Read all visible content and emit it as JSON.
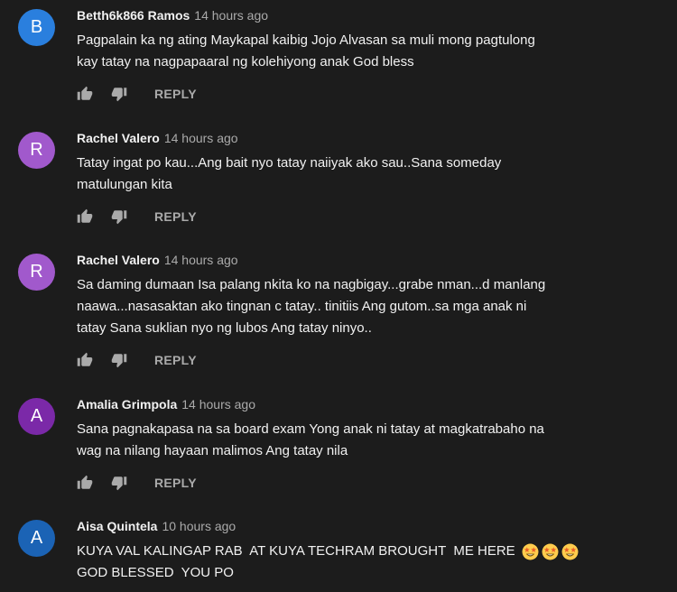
{
  "theme": {
    "background": "#1c1c1c",
    "text": "#f1f1f1",
    "secondary_text": "#aaaaaa"
  },
  "icons": {
    "like": "thumb-up-icon",
    "dislike": "thumb-down-icon",
    "emoji": "star-struck-emoji-icon"
  },
  "comments": [
    {
      "avatar_letter": "B",
      "avatar_color": "#2a7fde",
      "author": "Betth6k866 Ramos",
      "time": "14 hours ago",
      "text_lines": [
        "Pagpalain ka ng ating Maykapal kaibig Jojo Alvasan sa muli mong pagtulong",
        "kay tatay na nagpapaaral ng kolehiyong anak God bless"
      ],
      "reply_label": "REPLY"
    },
    {
      "avatar_letter": "R",
      "avatar_color": "#a159cc",
      "author": "Rachel Valero",
      "time": "14 hours ago",
      "text_lines": [
        "Tatay ingat po kau...Ang bait nyo tatay naiiyak ako sau..Sana someday",
        "matulungan kita"
      ],
      "reply_label": "REPLY"
    },
    {
      "avatar_letter": "R",
      "avatar_color": "#a159cc",
      "author": "Rachel Valero",
      "time": "14 hours ago",
      "text_lines": [
        "Sa daming dumaan Isa palang nkita ko na nagbigay...grabe nman...d manlang",
        "naawa...nasasaktan ako tingnan c tatay.. tinitiis Ang gutom..sa mga anak ni",
        "tatay Sana suklian nyo ng lubos Ang tatay ninyo.."
      ],
      "reply_label": "REPLY"
    },
    {
      "avatar_letter": "A",
      "avatar_color": "#7b29a8",
      "author": "Amalia Grimpola",
      "time": "14 hours ago",
      "text_lines": [
        "Sana pagnakapasa na sa board exam Yong anak ni tatay at magkatrabaho na",
        "wag na nilang hayaan malimos Ang tatay nila"
      ],
      "reply_label": "REPLY"
    },
    {
      "avatar_letter": "A",
      "avatar_color": "#1b63b5",
      "author": "Aisa Quintela",
      "time": "10 hours ago",
      "text_lines": [
        "KUYA VAL KALINGAP RAB  AT KUYA TECHRAM BROUGHT  ME HERE ",
        "GOD BLESSED  YOU PO"
      ],
      "emoji": [
        "star-struck-emoji-icon",
        "star-struck-emoji-icon",
        "star-struck-emoji-icon"
      ]
    }
  ]
}
